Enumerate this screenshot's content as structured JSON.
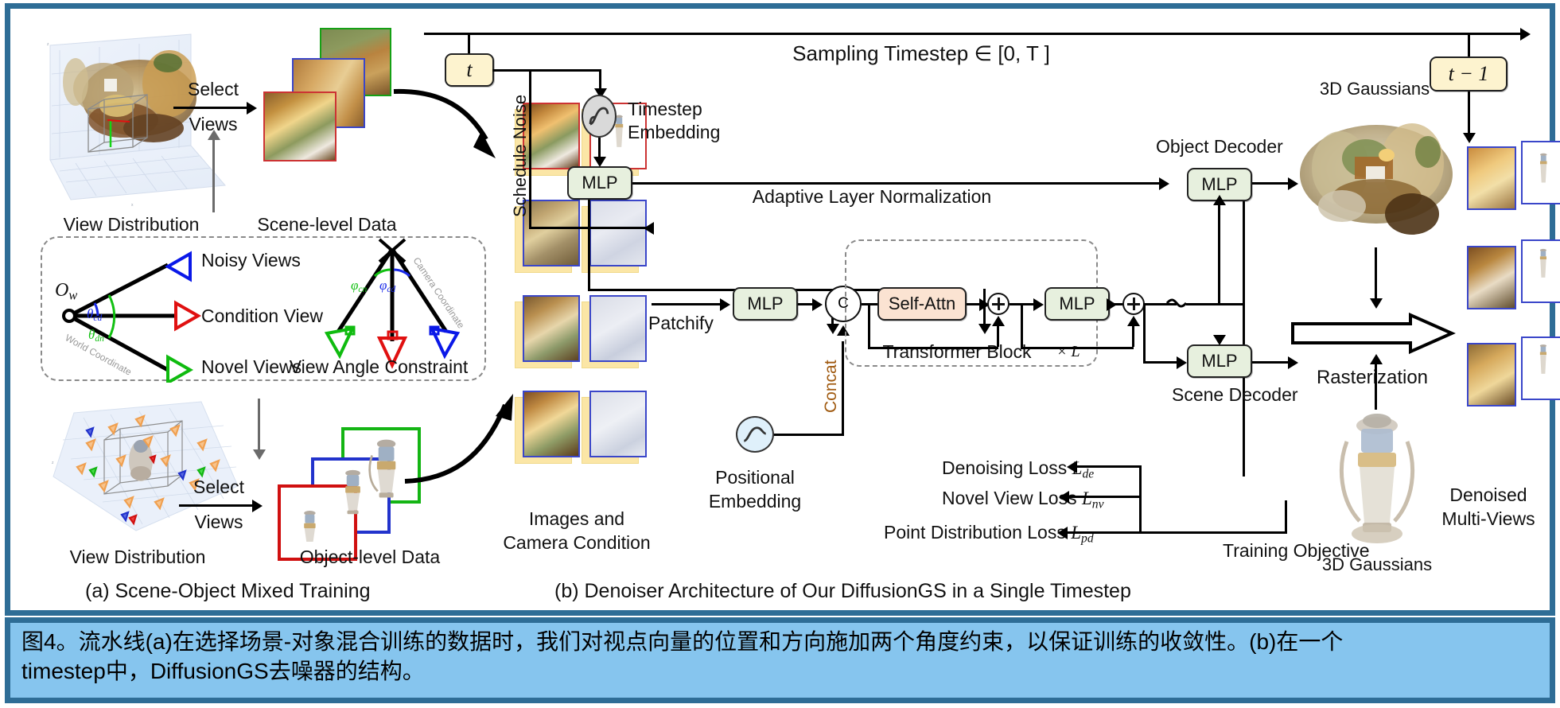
{
  "figure": {
    "frame_color": "#2e6d96",
    "caption_bg": "#86c5ee",
    "caption": "图4。流水线(a)在选择场景-对象混合训练的数据时，我们对视点向量的位置和方向施加两个角度约束，以保证训练的收敛性。(b)在一个\ntimestep中，DiffusionGS去噪器的结构。"
  },
  "panel_a": {
    "title": "(a) Scene-Object Mixed Training",
    "scene_view_distribution": "View Distribution",
    "scene_level_data": "Scene-level Data",
    "object_view_distribution": "View Distribution",
    "object_level_data": "Object-level Data",
    "select_top": "Select",
    "views_top": "Views",
    "select_bottom": "Select",
    "views_bottom": "Views",
    "constraint": {
      "noisy_views": "Noisy Views",
      "condition_view": "Condition View",
      "novel_views": "Novel Views",
      "view_angle_constraint": "View Angle Constraint",
      "origin": "O",
      "origin_sub": "w",
      "theta_cd": "θ",
      "theta_cd_sub": "cd",
      "theta_dn": "θ",
      "theta_dn_sub": "dn",
      "phi_cn": "φ",
      "phi_cn_sub": "cn",
      "phi_cd": "φ",
      "phi_cd_sub": "cd",
      "world_coordinate": "World Coordinate",
      "camera_coordinate": "Camera Coordinate"
    }
  },
  "panel_b": {
    "title": "(b) Denoiser Architecture of Our DiffusionGS in a Single Timestep",
    "timestep_in": "t",
    "timestep_out": "t − 1",
    "sampling_timestep": "Sampling Timestep  ∈ [0,  T ]",
    "schedule_noise": "Schedule Noise",
    "timestep_embedding": "Timestep\nEmbedding",
    "timestep_embedding_l1": "Timestep",
    "timestep_embedding_l2": "Embedding",
    "positional_embedding_l1": "Positional",
    "positional_embedding_l2": "Embedding",
    "mlp_adaln": "MLP",
    "mlp_patchify": "MLP",
    "mlp_selfattn": "MLP",
    "mlp_object_decoder": "MLP",
    "mlp_scene_decoder": "MLP",
    "adaptive_layer_norm": "Adaptive Layer Normalization",
    "self_attn": "Self-Attn",
    "concat_symbol": "C",
    "concat_label": "Concat",
    "patchify": "Patchify",
    "transformer_block": "Transformer Block",
    "transformer_repeat": "× L",
    "images_and_camera_condition_l1": "Images and",
    "images_and_camera_condition_l2": "Camera Condition",
    "object_decoder": "Object Decoder",
    "scene_decoder": "Scene Decoder",
    "gaussians_top": "3D Gaussians",
    "gaussians_bottom": "3D Gaussians",
    "rasterization": "Rasterization",
    "denoised_l1": "Denoised",
    "denoised_l2": "Multi-Views",
    "training_objective": "Training Objective",
    "losses": [
      {
        "name": "Denoising Loss",
        "sym": "L",
        "sub": "de"
      },
      {
        "name": "Novel View Loss",
        "sym": "L",
        "sub": "nv"
      },
      {
        "name": "Point Distribution Loss",
        "sym": "L",
        "sub": "pd"
      }
    ]
  },
  "colors": {
    "mlp_fill": "#e7f0de",
    "attn_fill": "#fbe3d2",
    "timestep_fill": "#fdf3cf",
    "noisy": "#0a18e8",
    "condition": "#e01010",
    "novel": "#0fbb0f",
    "frame": "#2e6d96"
  }
}
